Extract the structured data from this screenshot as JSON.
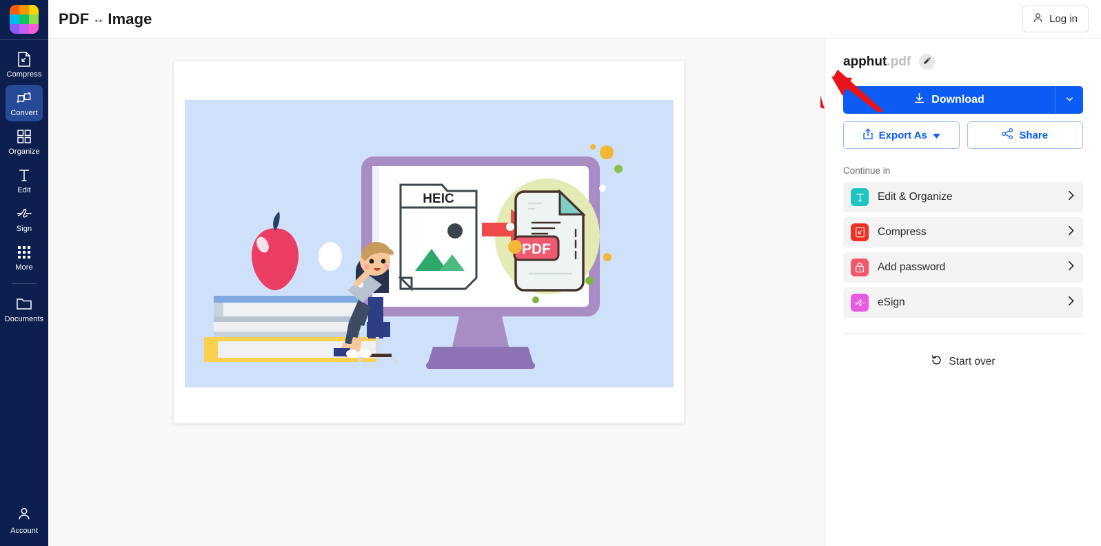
{
  "app": {
    "logo_name": "app-logo-grid",
    "logo_colors": [
      "#fa5d0a",
      "#f89400",
      "#ffd400",
      "#00bcf2",
      "#11c463",
      "#8ede4c",
      "#8a5cf6",
      "#c95cf6",
      "#f85cd6"
    ]
  },
  "sidebar": {
    "items": [
      {
        "label": "Compress",
        "icon": "compress-icon",
        "active": false
      },
      {
        "label": "Convert",
        "icon": "convert-icon",
        "active": true
      },
      {
        "label": "Organize",
        "icon": "organize-icon",
        "active": false
      },
      {
        "label": "Edit",
        "icon": "edit-text-icon",
        "active": false
      },
      {
        "label": "Sign",
        "icon": "sign-icon",
        "active": false
      },
      {
        "label": "More",
        "icon": "grid-dots-icon",
        "active": false
      },
      {
        "label": "Documents",
        "icon": "folder-icon",
        "active": false
      }
    ],
    "account": {
      "label": "Account",
      "icon": "user-icon"
    }
  },
  "header": {
    "title_left": "PDF",
    "title_swap": "↔",
    "title_right": "Image",
    "login_label": "Log in",
    "login_icon": "user-icon"
  },
  "panel": {
    "file_basename": "apphut",
    "file_extension": ".pdf",
    "rename_icon": "pencil-icon",
    "download_label": "Download",
    "download_icon": "download-icon",
    "download_caret_icon": "chevron-down-icon",
    "export_label": "Export As",
    "export_icon": "share-up-icon",
    "export_caret_icon": "caret-down-icon",
    "share_label": "Share",
    "share_icon": "share-nodes-icon",
    "continue_label": "Continue in",
    "continue_items": [
      {
        "label": "Edit & Organize",
        "icon": "text-tool-icon",
        "color": "#1fc4c0",
        "chevron": "chevron-right-icon"
      },
      {
        "label": "Compress",
        "icon": "compress-icon",
        "color": "#ee3124",
        "chevron": "chevron-right-icon"
      },
      {
        "label": "Add password",
        "icon": "lock-icon",
        "color": "#f4576b",
        "chevron": "chevron-right-icon"
      },
      {
        "label": "eSign",
        "icon": "signature-icon",
        "color": "#e95ae0",
        "chevron": "chevron-right-icon"
      }
    ],
    "start_over_label": "Start over",
    "start_over_icon": "rotate-ccw-icon",
    "accent_color": "#0b5cf5"
  },
  "canvas": {
    "document_preview_name": "pdf-page-preview",
    "illustration": {
      "background": "#cfe1fa",
      "source_file_label": "HEIC",
      "target_file_label": "PDF",
      "arrow_color": "#ee4a4a",
      "monitor_color": "#a78dc4"
    }
  },
  "annotation": {
    "arrow_color": "#e8141a",
    "points_to": "download-button"
  }
}
